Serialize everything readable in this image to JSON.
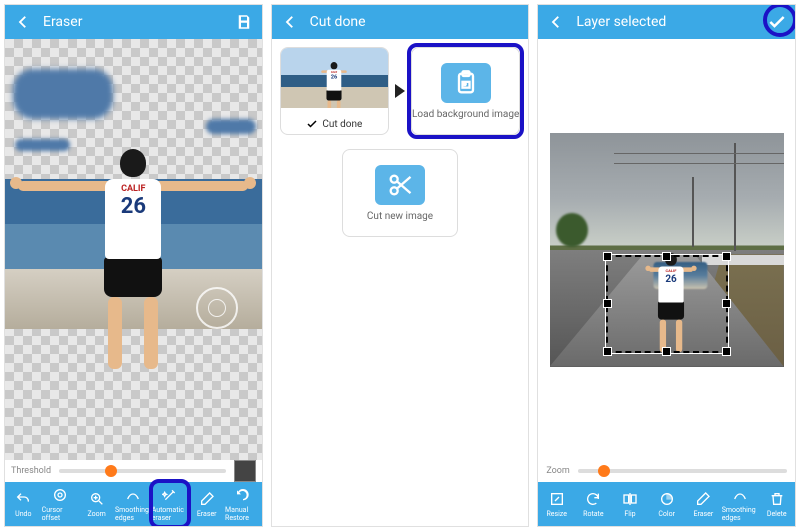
{
  "panel1": {
    "title": "Eraser",
    "threshold_label": "Threshold",
    "jersey_text": "CALIF",
    "jersey_number": "26",
    "tools": [
      {
        "label": "Undo"
      },
      {
        "label": "Cursor offset"
      },
      {
        "label": "Zoom"
      },
      {
        "label": "Smoothing edges"
      },
      {
        "label": "Automatic eraser"
      },
      {
        "label": "Eraser"
      },
      {
        "label": "Manual Restore"
      }
    ]
  },
  "panel2": {
    "title": "Cut done",
    "cut_done_label": "Cut done",
    "load_bg_label": "Load background image",
    "cut_new_label": "Cut new image"
  },
  "panel3": {
    "title": "Layer selected",
    "zoom_label": "Zoom",
    "jersey_number": "26",
    "tools": [
      {
        "label": "Resize"
      },
      {
        "label": "Rotate"
      },
      {
        "label": "Flip"
      },
      {
        "label": "Color"
      },
      {
        "label": "Eraser"
      },
      {
        "label": "Smoothing edges"
      },
      {
        "label": "Delete"
      }
    ]
  }
}
